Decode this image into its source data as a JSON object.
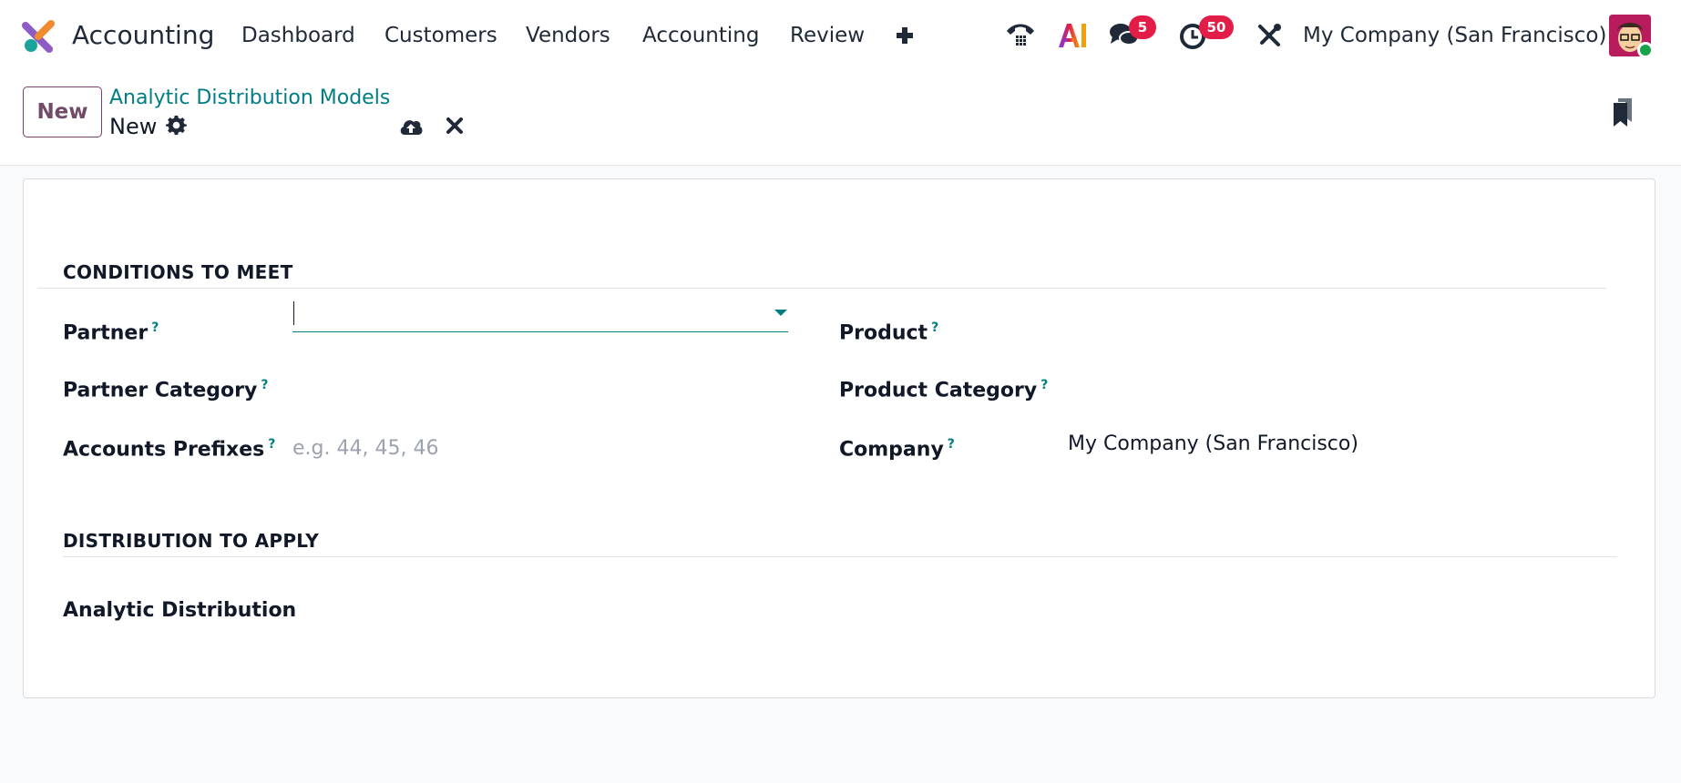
{
  "navbar": {
    "app_name": "Accounting",
    "menu": [
      "Dashboard",
      "Customers",
      "Vendors",
      "Accounting",
      "Review"
    ],
    "chat_badge": "5",
    "activity_badge": "50",
    "company": "My Company (San Francisco)",
    "icons": [
      "phone-icon",
      "ai-icon",
      "chat-icon",
      "clock-icon",
      "tools-icon"
    ]
  },
  "control_panel": {
    "new_label": "New",
    "breadcrumb": "Analytic Distribution Models",
    "record_name": "New"
  },
  "form": {
    "conditions_title": "CONDITIONS TO MEET",
    "partner_label": "Partner",
    "partner_value": "",
    "partner_category_label": "Partner Category",
    "accounts_prefixes_label": "Accounts Prefixes",
    "accounts_prefixes_placeholder": "e.g. 44, 45, 46",
    "product_label": "Product",
    "product_category_label": "Product Category",
    "company_label": "Company",
    "company_value": "My Company (San Francisco)",
    "help_mark": "?",
    "distribution_title": "DISTRIBUTION TO APPLY",
    "analytic_distribution_label": "Analytic Distribution"
  },
  "colors": {
    "brand": "#714b67",
    "accent": "#017e84",
    "badge": "#e11d48"
  }
}
